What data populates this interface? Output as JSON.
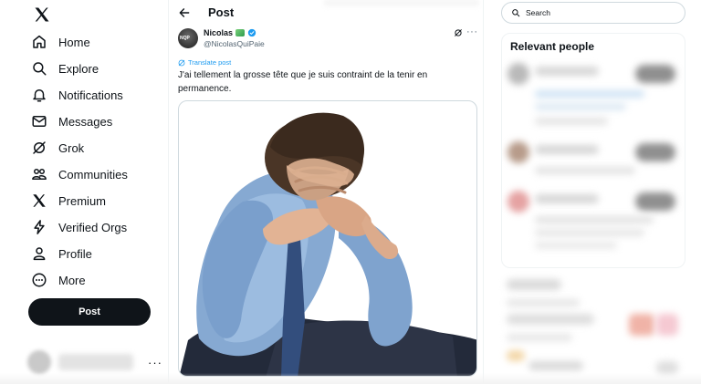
{
  "sidebar": {
    "logo_icon": "x-logo-icon",
    "items": [
      {
        "label": "Home",
        "icon": "home-icon"
      },
      {
        "label": "Explore",
        "icon": "search-icon"
      },
      {
        "label": "Notifications",
        "icon": "bell-icon"
      },
      {
        "label": "Messages",
        "icon": "envelope-icon"
      },
      {
        "label": "Grok",
        "icon": "grok-icon"
      },
      {
        "label": "Communities",
        "icon": "people-icon"
      },
      {
        "label": "Premium",
        "icon": "x-premium-icon"
      },
      {
        "label": "Verified Orgs",
        "icon": "lightning-icon"
      },
      {
        "label": "Profile",
        "icon": "person-icon"
      },
      {
        "label": "More",
        "icon": "more-circle-icon"
      }
    ],
    "post_button": "Post",
    "account_more": "···"
  },
  "main": {
    "title": "Post",
    "post": {
      "author_name": "Nicolas",
      "author_handle": "@NicolasQuiPaie",
      "translate_label": "Translate post",
      "text": "J'ai tellement la grosse tête que je suis contraint de la tenir en permanence.",
      "more": "···"
    }
  },
  "right": {
    "search_placeholder": "Search",
    "relevant_title": "Relevant people"
  },
  "colors": {
    "accent": "#1d9bf0",
    "text": "#0f1419",
    "secondary": "#536471",
    "border": "#cfd9de",
    "post_button_bg": "#0f1419"
  }
}
